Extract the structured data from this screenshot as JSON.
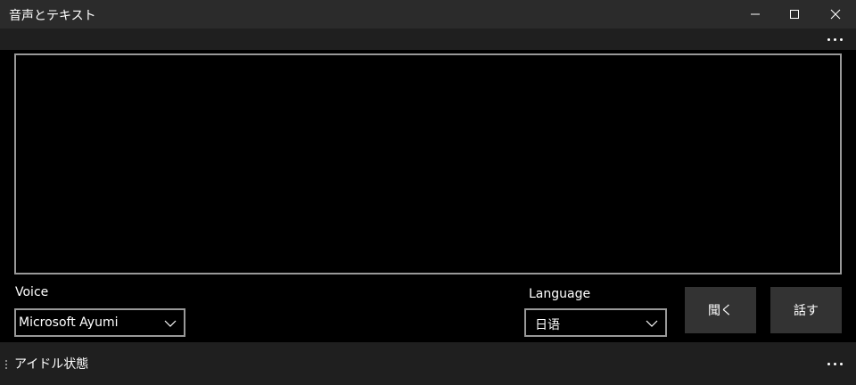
{
  "window": {
    "title": "音声とテキスト",
    "minimize_icon": "minimize-icon",
    "maximize_icon": "maximize-icon",
    "close_icon": "close-icon"
  },
  "command_bar": {
    "more_icon": "more-icon"
  },
  "text_area": {
    "value": "",
    "border_color": "#999999"
  },
  "voice": {
    "label": "Voice",
    "selected": "Microsoft Ayumi"
  },
  "language": {
    "label": "Language",
    "selected": "日语"
  },
  "buttons": {
    "listen": "聞く",
    "speak": "話す"
  },
  "status_bar": {
    "text": "アイドル状態",
    "more_icon": "more-icon"
  },
  "colors": {
    "background": "#000000",
    "titlebar": "#2b2b2b",
    "bar": "#1f1f1f",
    "button": "#333333",
    "border": "#999999"
  }
}
